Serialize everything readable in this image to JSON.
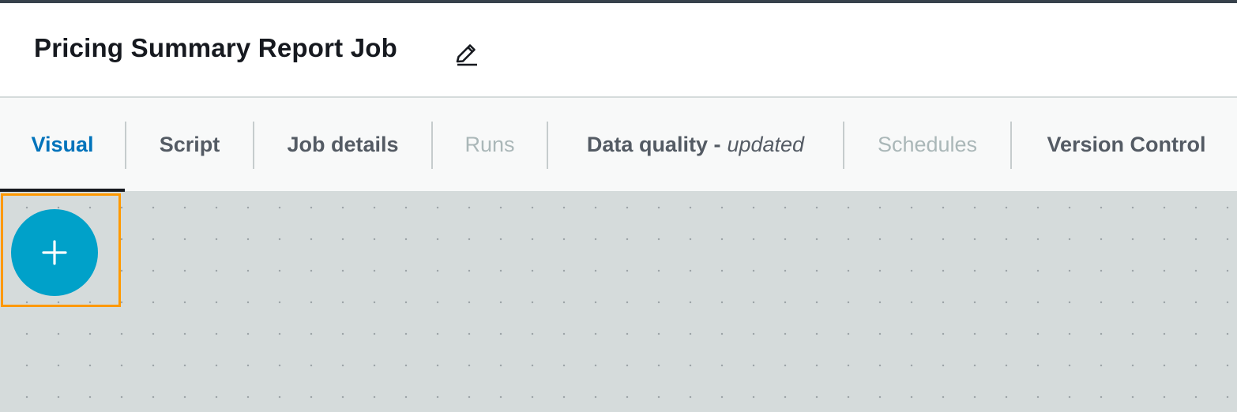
{
  "header": {
    "title": "Pricing Summary Report Job",
    "edit_icon": "pencil-icon"
  },
  "tabs": [
    {
      "label": "Visual",
      "state": "active"
    },
    {
      "label": "Script",
      "state": "enabled"
    },
    {
      "label": "Job details",
      "state": "enabled"
    },
    {
      "label": "Runs",
      "state": "disabled"
    },
    {
      "label": "Data quality -",
      "suffix": "updated",
      "state": "enabled"
    },
    {
      "label": "Schedules",
      "state": "disabled"
    },
    {
      "label": "Version Control",
      "state": "enabled"
    }
  ],
  "canvas": {
    "add_button_icon": "plus-icon",
    "highlight_color": "#ff9900",
    "add_button_color": "#00a1c9"
  },
  "colors": {
    "active_tab": "#0073bb",
    "tab_text": "#545b64",
    "disabled_tab": "#aab7b8",
    "canvas_bg": "#d5dbdb"
  }
}
